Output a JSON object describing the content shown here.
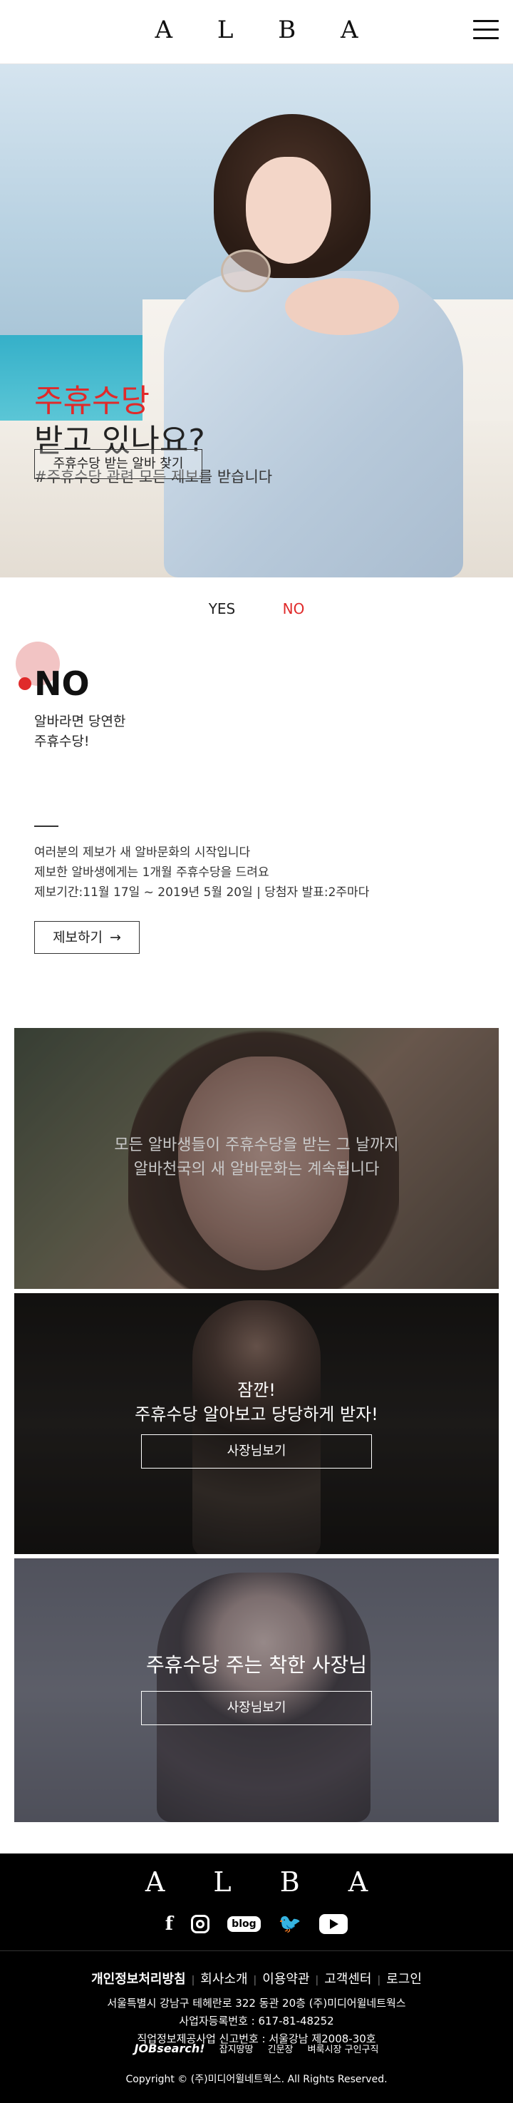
{
  "header": {
    "logo": "A L B A",
    "menu_icon": "hamburger-icon"
  },
  "hero": {
    "title_red": "주휴수당",
    "title_black": "받고 있나요?",
    "subtitle": "#주휴수당 관련 모든 제보를 받습니다",
    "button_label": "주휴수당 받는 알바 찾기"
  },
  "choice": {
    "yes": "YES",
    "no": "NO"
  },
  "no_section": {
    "title": "NO",
    "desc_line1": "알바라면 당연한",
    "desc_line2": "주휴수당!",
    "info_line1": "여러분의 제보가 새 알바문화의 시작입니다",
    "info_line2": "제보한 알바생에게는 1개월 주휴수당을 드려요",
    "info_line3": "제보기간:11월 17일 ~ 2019년 5월 20일 | 당첨자 발표:2주마다",
    "report_label": "제보하기",
    "report_arrow": "→"
  },
  "panels": {
    "p1_line1": "모든 알바생들이 주휴수당을 받는 그 날까지",
    "p1_line2": "알바천국의 새 알바문화는 계속됩니다",
    "p2_line1": "잠깐!",
    "p2_line2": "주휴수당 알아보고 당당하게 받자!",
    "p2_button": "사장님보기",
    "p3_line1": "주휴수당 주는 착한 사장님",
    "p3_button": "사장님보기"
  },
  "footer": {
    "logo": "A L B A",
    "blog_label": "blog",
    "links": [
      "개인정보처리방침",
      "회사소개",
      "이용약관",
      "고객센터",
      "로그인"
    ],
    "address": "서울특별시 강남구 테헤란로 322 동관 20층 (주)미디어윌네트웍스",
    "business_no": "사업자등록번호 : 617-81-48252",
    "job_license": "직업정보제공사업 신고번호 : 서울강남 제2008-30호",
    "brands": [
      "JOBsearch!",
      "잡지땅땅",
      "긴문장",
      "벼룩시장 구인구직"
    ],
    "copyright": "Copyright © (주)미디어윌네트웍스. All Rights Reserved."
  }
}
